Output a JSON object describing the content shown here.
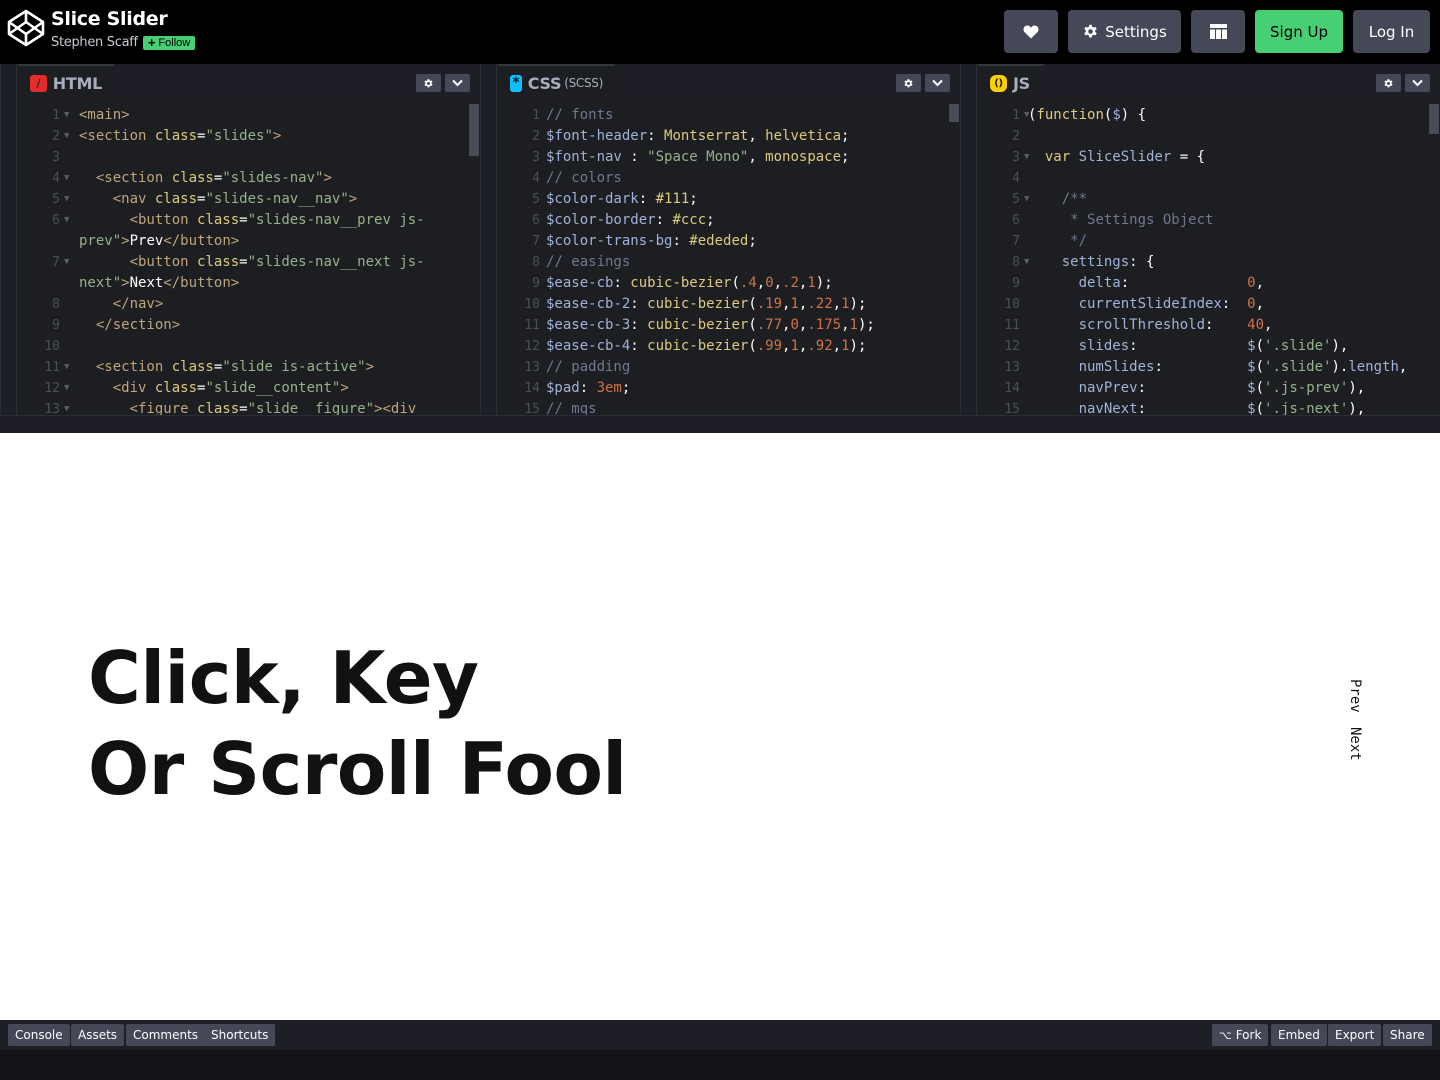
{
  "header": {
    "title": "Slice Slider",
    "author": "Stephen Scaff",
    "follow_label": "Follow",
    "settings_label": "Settings",
    "signup_label": "Sign Up",
    "login_label": "Log In"
  },
  "editors": {
    "html": {
      "label": "HTML",
      "icon": "/"
    },
    "css": {
      "label": "CSS",
      "sublabel": "(SCSS)",
      "icon": "*"
    },
    "js": {
      "label": "JS",
      "icon": "()"
    }
  },
  "preview": {
    "heading_line1": "Click, Key",
    "heading_line2": "Or Scroll Fool",
    "nav_prev": "Prev",
    "nav_next": "Next"
  },
  "footer": {
    "console": "Console",
    "assets": "Assets",
    "comments": "Comments",
    "shortcuts": "Shortcuts",
    "fork": "Fork",
    "embed": "Embed",
    "export": "Export",
    "share": "Share"
  },
  "colors": {
    "header_bg": "#000000",
    "editor_bg": "#1d1e22",
    "button_bg": "#444857",
    "accent_green": "#47cf73",
    "html_icon": "#e42c2c",
    "css_icon": "#0ebeff",
    "js_icon": "#fcd000"
  },
  "code": {
    "html": [
      {
        "n": "1",
        "fold": true,
        "tokens": [
          [
            "tg",
            "<main>"
          ]
        ]
      },
      {
        "n": "2",
        "fold": true,
        "tokens": [
          [
            "tg",
            "<section "
          ],
          [
            "at",
            "class"
          ],
          [
            "df",
            "="
          ],
          [
            "st",
            "\"slides\""
          ],
          [
            "tg",
            ">"
          ]
        ]
      },
      {
        "n": "3",
        "tokens": []
      },
      {
        "n": "4",
        "fold": true,
        "tokens": [
          [
            "df",
            "  "
          ],
          [
            "tg",
            "<section "
          ],
          [
            "at",
            "class"
          ],
          [
            "df",
            "="
          ],
          [
            "st",
            "\"slides-nav\""
          ],
          [
            "tg",
            ">"
          ]
        ]
      },
      {
        "n": "5",
        "fold": true,
        "tokens": [
          [
            "df",
            "    "
          ],
          [
            "tg",
            "<nav "
          ],
          [
            "at",
            "class"
          ],
          [
            "df",
            "="
          ],
          [
            "st",
            "\"slides-nav__nav\""
          ],
          [
            "tg",
            ">"
          ]
        ]
      },
      {
        "n": "6",
        "fold": true,
        "tall": true,
        "tokens": [
          [
            "df",
            "      "
          ],
          [
            "tg",
            "<button "
          ],
          [
            "at",
            "class"
          ],
          [
            "df",
            "="
          ],
          [
            "st",
            "\"slides-nav__prev js-prev\""
          ],
          [
            "tg",
            ">"
          ],
          [
            "df",
            "Prev"
          ],
          [
            "tg",
            "</button>"
          ]
        ]
      },
      {
        "n": "7",
        "fold": true,
        "tall": true,
        "tokens": [
          [
            "df",
            "      "
          ],
          [
            "tg",
            "<button "
          ],
          [
            "at",
            "class"
          ],
          [
            "df",
            "="
          ],
          [
            "st",
            "\"slides-nav__next js-next\""
          ],
          [
            "tg",
            ">"
          ],
          [
            "df",
            "Next"
          ],
          [
            "tg",
            "</button>"
          ]
        ]
      },
      {
        "n": "8",
        "tokens": [
          [
            "df",
            "    "
          ],
          [
            "tg",
            "</nav>"
          ]
        ]
      },
      {
        "n": "9",
        "tokens": [
          [
            "df",
            "  "
          ],
          [
            "tg",
            "</section>"
          ]
        ]
      },
      {
        "n": "10",
        "tokens": []
      },
      {
        "n": "11",
        "fold": true,
        "tokens": [
          [
            "df",
            "  "
          ],
          [
            "tg",
            "<section "
          ],
          [
            "at",
            "class"
          ],
          [
            "df",
            "="
          ],
          [
            "st",
            "\"slide is-active\""
          ],
          [
            "tg",
            ">"
          ]
        ]
      },
      {
        "n": "12",
        "fold": true,
        "tokens": [
          [
            "df",
            "    "
          ],
          [
            "tg",
            "<div "
          ],
          [
            "at",
            "class"
          ],
          [
            "df",
            "="
          ],
          [
            "st",
            "\"slide__content\""
          ],
          [
            "tg",
            ">"
          ]
        ]
      },
      {
        "n": "13",
        "fold": true,
        "tokens": [
          [
            "df",
            "      "
          ],
          [
            "tg",
            "<figure "
          ],
          [
            "at",
            "class"
          ],
          [
            "df",
            "="
          ],
          [
            "st",
            "\"slide__figure\""
          ],
          [
            "tg",
            "><div"
          ]
        ]
      }
    ],
    "css": [
      {
        "n": "1",
        "tokens": [
          [
            "cm",
            "// fonts"
          ]
        ]
      },
      {
        "n": "2",
        "tokens": [
          [
            "vr",
            "$font-header"
          ],
          [
            "df",
            ": "
          ],
          [
            "kw",
            "Montserrat"
          ],
          [
            "df",
            ", "
          ],
          [
            "kw",
            "helvetica"
          ],
          [
            "df",
            ";"
          ]
        ]
      },
      {
        "n": "3",
        "tokens": [
          [
            "vr",
            "$font-nav"
          ],
          [
            "df",
            " : "
          ],
          [
            "st",
            "\"Space Mono\""
          ],
          [
            "df",
            ", "
          ],
          [
            "kw",
            "monospace"
          ],
          [
            "df",
            ";"
          ]
        ]
      },
      {
        "n": "4",
        "tokens": [
          [
            "cm",
            "// colors"
          ]
        ]
      },
      {
        "n": "5",
        "tokens": [
          [
            "vr",
            "$color-dark"
          ],
          [
            "df",
            ": "
          ],
          [
            "kw",
            "#111"
          ],
          [
            "df",
            ";"
          ]
        ]
      },
      {
        "n": "6",
        "tokens": [
          [
            "vr",
            "$color-border"
          ],
          [
            "df",
            ": "
          ],
          [
            "kw",
            "#ccc"
          ],
          [
            "df",
            ";"
          ]
        ]
      },
      {
        "n": "7",
        "tokens": [
          [
            "vr",
            "$color-trans-bg"
          ],
          [
            "df",
            ": "
          ],
          [
            "kw",
            "#ededed"
          ],
          [
            "df",
            ";"
          ]
        ]
      },
      {
        "n": "8",
        "tokens": [
          [
            "cm",
            "// easings"
          ]
        ]
      },
      {
        "n": "9",
        "tokens": [
          [
            "vr",
            "$ease-cb"
          ],
          [
            "df",
            ": "
          ],
          [
            "kw",
            "cubic-bezier"
          ],
          [
            "df",
            "("
          ],
          [
            "nm",
            ".4"
          ],
          [
            "df",
            ","
          ],
          [
            "nm",
            "0"
          ],
          [
            "df",
            ","
          ],
          [
            "nm",
            ".2"
          ],
          [
            "df",
            ","
          ],
          [
            "nm",
            "1"
          ],
          [
            "df",
            ");"
          ]
        ]
      },
      {
        "n": "10",
        "tokens": [
          [
            "vr",
            "$ease-cb-2"
          ],
          [
            "df",
            ": "
          ],
          [
            "kw",
            "cubic-bezier"
          ],
          [
            "df",
            "("
          ],
          [
            "nm",
            ".19"
          ],
          [
            "df",
            ","
          ],
          [
            "nm",
            "1"
          ],
          [
            "df",
            ","
          ],
          [
            "nm",
            ".22"
          ],
          [
            "df",
            ","
          ],
          [
            "nm",
            "1"
          ],
          [
            "df",
            ");"
          ]
        ]
      },
      {
        "n": "11",
        "tokens": [
          [
            "vr",
            "$ease-cb-3"
          ],
          [
            "df",
            ": "
          ],
          [
            "kw",
            "cubic-bezier"
          ],
          [
            "df",
            "("
          ],
          [
            "nm",
            ".77"
          ],
          [
            "df",
            ","
          ],
          [
            "nm",
            "0"
          ],
          [
            "df",
            ","
          ],
          [
            "nm",
            ".175"
          ],
          [
            "df",
            ","
          ],
          [
            "nm",
            "1"
          ],
          [
            "df",
            ");"
          ]
        ]
      },
      {
        "n": "12",
        "tokens": [
          [
            "vr",
            "$ease-cb-4"
          ],
          [
            "df",
            ": "
          ],
          [
            "kw",
            "cubic-bezier"
          ],
          [
            "df",
            "("
          ],
          [
            "nm",
            ".99"
          ],
          [
            "df",
            ","
          ],
          [
            "nm",
            "1"
          ],
          [
            "df",
            ","
          ],
          [
            "nm",
            ".92"
          ],
          [
            "df",
            ","
          ],
          [
            "nm",
            "1"
          ],
          [
            "df",
            ");"
          ]
        ]
      },
      {
        "n": "13",
        "tokens": [
          [
            "cm",
            "// padding"
          ]
        ]
      },
      {
        "n": "14",
        "tokens": [
          [
            "vr",
            "$pad"
          ],
          [
            "df",
            ": "
          ],
          [
            "nm",
            "3em"
          ],
          [
            "df",
            ";"
          ]
        ]
      },
      {
        "n": "15",
        "tokens": [
          [
            "cm",
            "// mqs"
          ]
        ]
      }
    ],
    "js": [
      {
        "n": "1",
        "fold": true,
        "tokens": [
          [
            "df",
            "("
          ],
          [
            "kw",
            "function"
          ],
          [
            "df",
            "("
          ],
          [
            "vr",
            "$"
          ],
          [
            "df",
            ") {"
          ]
        ]
      },
      {
        "n": "2",
        "tokens": []
      },
      {
        "n": "3",
        "fold": true,
        "tokens": [
          [
            "df",
            "  "
          ],
          [
            "kw",
            "var "
          ],
          [
            "vr",
            "SliceSlider"
          ],
          [
            "df",
            " = {"
          ]
        ]
      },
      {
        "n": "4",
        "tokens": []
      },
      {
        "n": "5",
        "fold": true,
        "tokens": [
          [
            "df",
            "    "
          ],
          [
            "cm",
            "/**"
          ]
        ]
      },
      {
        "n": "6",
        "tokens": [
          [
            "df",
            "     "
          ],
          [
            "cm",
            "* Settings Object"
          ]
        ]
      },
      {
        "n": "7",
        "tokens": [
          [
            "df",
            "     "
          ],
          [
            "cm",
            "*/"
          ]
        ]
      },
      {
        "n": "8",
        "fold": true,
        "tokens": [
          [
            "df",
            "    "
          ],
          [
            "vr",
            "settings"
          ],
          [
            "df",
            ": {"
          ]
        ]
      },
      {
        "n": "9",
        "tokens": [
          [
            "df",
            "      "
          ],
          [
            "vr",
            "delta"
          ],
          [
            "df",
            ":              "
          ],
          [
            "nm",
            "0"
          ],
          [
            "df",
            ","
          ]
        ]
      },
      {
        "n": "10",
        "tokens": [
          [
            "df",
            "      "
          ],
          [
            "vr",
            "currentSlideIndex"
          ],
          [
            "df",
            ":  "
          ],
          [
            "nm",
            "0"
          ],
          [
            "df",
            ","
          ]
        ]
      },
      {
        "n": "11",
        "tokens": [
          [
            "df",
            "      "
          ],
          [
            "vr",
            "scrollThreshold"
          ],
          [
            "df",
            ":    "
          ],
          [
            "nm",
            "40"
          ],
          [
            "df",
            ","
          ]
        ]
      },
      {
        "n": "12",
        "tokens": [
          [
            "df",
            "      "
          ],
          [
            "vr",
            "slides"
          ],
          [
            "df",
            ":             "
          ],
          [
            "vr",
            "$"
          ],
          [
            "df",
            "("
          ],
          [
            "st",
            "'.slide'"
          ],
          [
            "df",
            "),"
          ]
        ]
      },
      {
        "n": "13",
        "tokens": [
          [
            "df",
            "      "
          ],
          [
            "vr",
            "numSlides"
          ],
          [
            "df",
            ":          "
          ],
          [
            "vr",
            "$"
          ],
          [
            "df",
            "("
          ],
          [
            "st",
            "'.slide'"
          ],
          [
            "df",
            ")."
          ],
          [
            "vr",
            "length"
          ],
          [
            "df",
            ","
          ]
        ]
      },
      {
        "n": "14",
        "tokens": [
          [
            "df",
            "      "
          ],
          [
            "vr",
            "navPrev"
          ],
          [
            "df",
            ":            "
          ],
          [
            "vr",
            "$"
          ],
          [
            "df",
            "("
          ],
          [
            "st",
            "'.js-prev'"
          ],
          [
            "df",
            "),"
          ]
        ]
      },
      {
        "n": "15",
        "tokens": [
          [
            "df",
            "      "
          ],
          [
            "vr",
            "navNext"
          ],
          [
            "df",
            ":            "
          ],
          [
            "vr",
            "$"
          ],
          [
            "df",
            "("
          ],
          [
            "st",
            "'.js-next'"
          ],
          [
            "df",
            "),"
          ]
        ]
      }
    ]
  }
}
